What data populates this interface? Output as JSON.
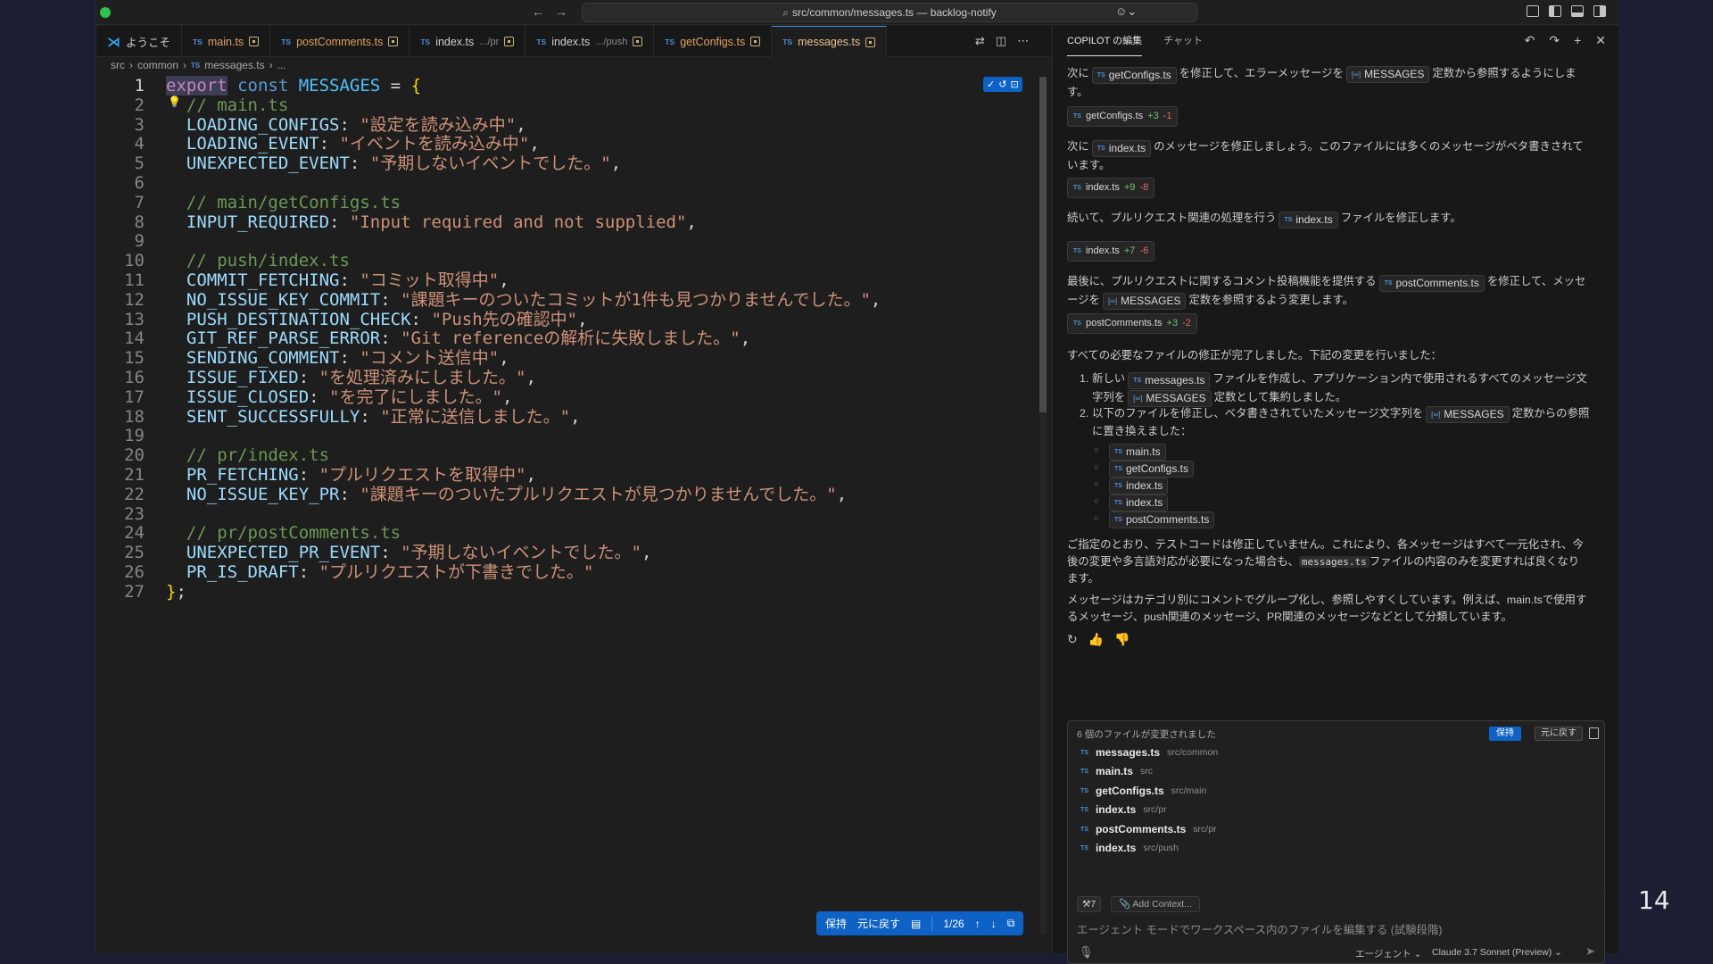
{
  "window": {
    "command_center": "src/common/messages.ts — backlog-notify",
    "slide_number": "14"
  },
  "tabs": [
    {
      "label": "ようこそ",
      "kind": "welcome"
    },
    {
      "label": "main.ts",
      "kind": "ts"
    },
    {
      "label": "postComments.ts",
      "kind": "ts"
    },
    {
      "label": "index.ts",
      "hint": ".../pr",
      "kind": "ts"
    },
    {
      "label": "index.ts",
      "hint": ".../push",
      "kind": "ts"
    },
    {
      "label": "getConfigs.ts",
      "kind": "ts"
    },
    {
      "label": "messages.ts",
      "kind": "ts",
      "active": true
    }
  ],
  "breadcrumb": {
    "seg1": "src",
    "seg2": "common",
    "file": "messages.ts",
    "tail": "..."
  },
  "code": {
    "lines": [
      {
        "n": "1",
        "html": "export const MESSAGES = {"
      },
      {
        "n": "2",
        "text": "  // main.ts"
      },
      {
        "n": "3",
        "key": "LOADING_CONFIGS",
        "val": "\"設定を読み込み中\","
      },
      {
        "n": "4",
        "key": "LOADING_EVENT",
        "val": "\"イベントを読み込み中\","
      },
      {
        "n": "5",
        "key": "UNEXPECTED_EVENT",
        "val": "\"予期しないイベントでした。\","
      },
      {
        "n": "6",
        "text": ""
      },
      {
        "n": "7",
        "text": "  // main/getConfigs.ts"
      },
      {
        "n": "8",
        "key": "INPUT_REQUIRED",
        "val": "\"Input required and not supplied\","
      },
      {
        "n": "9",
        "text": ""
      },
      {
        "n": "10",
        "text": "  // push/index.ts"
      },
      {
        "n": "11",
        "key": "COMMIT_FETCHING",
        "val": "\"コミット取得中\","
      },
      {
        "n": "12",
        "key": "NO_ISSUE_KEY_COMMIT",
        "val": "\"課題キーのついたコミットが1件も見つかりませんでした。\","
      },
      {
        "n": "13",
        "key": "PUSH_DESTINATION_CHECK",
        "val": "\"Push先の確認中\","
      },
      {
        "n": "14",
        "key": "GIT_REF_PARSE_ERROR",
        "val": "\"Git referenceの解析に失敗しました。\","
      },
      {
        "n": "15",
        "key": "SENDING_COMMENT",
        "val": "\"コメント送信中\","
      },
      {
        "n": "16",
        "key": "ISSUE_FIXED",
        "val": "\"を処理済みにしました。\","
      },
      {
        "n": "17",
        "key": "ISSUE_CLOSED",
        "val": "\"を完了にしました。\","
      },
      {
        "n": "18",
        "key": "SENT_SUCCESSFULLY",
        "val": "\"正常に送信しました。\","
      },
      {
        "n": "19",
        "text": ""
      },
      {
        "n": "20",
        "text": "  // pr/index.ts"
      },
      {
        "n": "21",
        "key": "PR_FETCHING",
        "val": "\"プルリクエストを取得中\","
      },
      {
        "n": "22",
        "key": "NO_ISSUE_KEY_PR",
        "val": "\"課題キーのついたプルリクエストが見つかりませんでした。\","
      },
      {
        "n": "23",
        "text": ""
      },
      {
        "n": "24",
        "text": "  // pr/postComments.ts"
      },
      {
        "n": "25",
        "key": "UNEXPECTED_PR_EVENT",
        "val": "\"予期しないイベントでした。\","
      },
      {
        "n": "26",
        "key": "PR_IS_DRAFT",
        "val": "\"プルリクエストが下書きでした。\""
      },
      {
        "n": "27",
        "text": "};"
      }
    ]
  },
  "review_bar": {
    "keep": "保持",
    "undo": "元に戻す",
    "position": "1/26"
  },
  "panel": {
    "tab_edits": "COPILOT の編集",
    "tab_chat": "チャット",
    "msg1_pre": "次に",
    "msg1_file": "getConfigs.ts",
    "msg1_mid": "を修正して、エラーメッセージを",
    "msg1_const": "MESSAGES",
    "msg1_post": "定数から参照するようにしま",
    "msg1_post2": "す。",
    "diff1": {
      "file": "getConfigs.ts",
      "add": "+3",
      "del": "-1"
    },
    "msg2_pre": "次に",
    "msg2_file": "index.ts",
    "msg2_post": "のメッセージを修正しましょう。このファイルには多くのメッセージがベタ書きされて",
    "msg2_post2": "います。",
    "diff2": {
      "file": "index.ts",
      "add": "+9",
      "del": "-8"
    },
    "msg3_pre": "続いて、プルリクエスト関連の処理を行う",
    "msg3_file": "index.ts",
    "msg3_post": "ファイルを修正します。",
    "diff3": {
      "file": "index.ts",
      "add": "+7",
      "del": "-6"
    },
    "msg4_pre": "最後に、プルリクエストに関するコメント投稿機能を提供する",
    "msg4_file": "postComments.ts",
    "msg4_mid": "を修正して、メッセ",
    "msg4_line2_pre": "ージを",
    "msg4_const": "MESSAGES",
    "msg4_post": "定数を参照するよう変更します。",
    "diff4": {
      "file": "postComments.ts",
      "add": "+3",
      "del": "-2"
    },
    "summary": "すべての必要なファイルの修正が完了しました。下記の変更を行いました：",
    "item1_pre": "新しい",
    "item1_file": "messages.ts",
    "item1_post": "ファイルを作成し、アプリケーション内で使用されるすべてのメッセージ文",
    "item1_line2_pre": "字列を",
    "item1_const": "MESSAGES",
    "item1_line2_post": "定数として集約しました。",
    "item2_pre": "以下のファイルを修正し、ベタ書きされていたメッセージ文字列を",
    "item2_const": "MESSAGES",
    "item2_post": "定数からの参照",
    "item2_line2": "に置き換えました：",
    "sub_files": [
      "main.ts",
      "getConfigs.ts",
      "index.ts",
      "index.ts",
      "postComments.ts"
    ],
    "note1": "ご指定のとおり、テストコードは修正していません。これにより、各メッセージはすべて一元化され、今",
    "note2_pre": "後の変更や多言語対応が必要になった場合も、",
    "note2_code": "messages.ts",
    "note2_post": "ファイルの内容のみを変更すれば良くなり",
    "note3": "ます。",
    "note4": "メッセージはカテゴリ別にコメントでグループ化し、参照しやすくしています。例えば、main.tsで使用す",
    "note5": "るメッセージ、push関連のメッセージ、PR関連のメッセージなどとして分類しています。"
  },
  "changes": {
    "heading": "6 個のファイルが変更されました",
    "keep": "保持",
    "undo": "元に戻す",
    "files": [
      {
        "name": "messages.ts",
        "dir": "src/common"
      },
      {
        "name": "main.ts",
        "dir": "src"
      },
      {
        "name": "getConfigs.ts",
        "dir": "src/main"
      },
      {
        "name": "index.ts",
        "dir": "src/pr"
      },
      {
        "name": "postComments.ts",
        "dir": "src/pr"
      },
      {
        "name": "index.ts",
        "dir": "src/push"
      }
    ]
  },
  "input": {
    "tools_count": "7",
    "add_context": "Add Context...",
    "placeholder": "エージェント モードでワークスペース内のファイルを編集する (試験段階)",
    "mode": "エージェント",
    "model": "Claude 3.7 Sonnet (Preview)"
  },
  "colors": {
    "accent": "#0e62c6",
    "string": "#ce9178",
    "comment": "#6a9955",
    "property": "#9cdcfe"
  }
}
